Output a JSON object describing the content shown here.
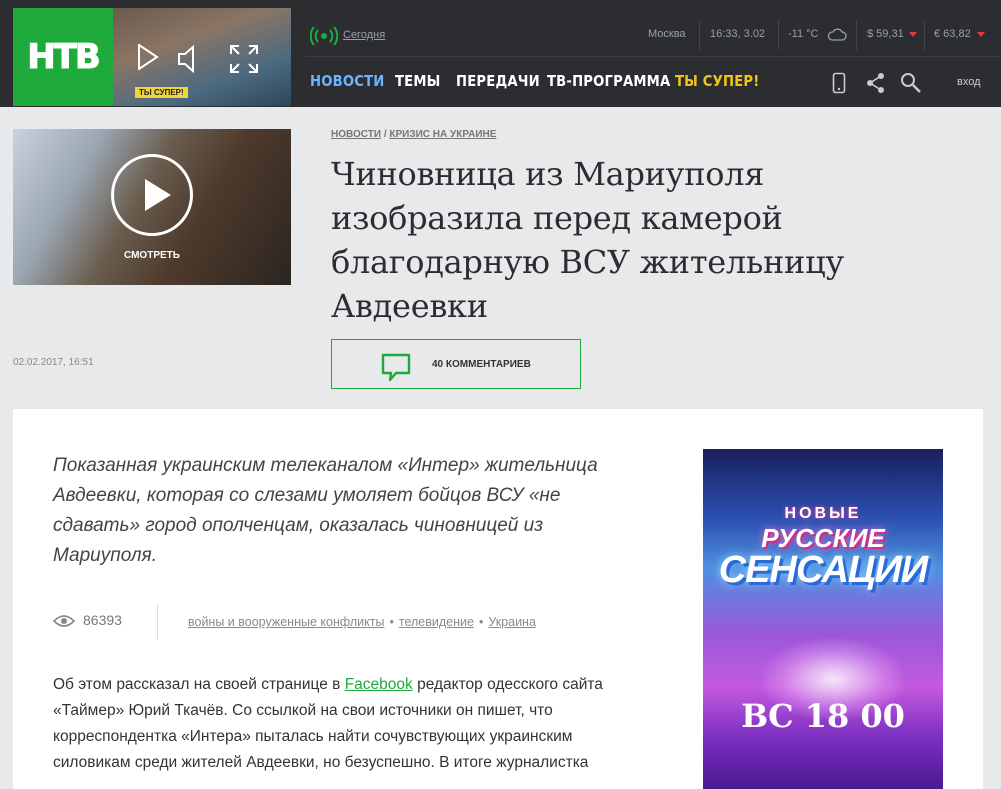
{
  "header": {
    "logo_text": "НТВ",
    "player_badge": "ТЫ СУПЕР!",
    "today_link": "Сегодня",
    "city": "Москва",
    "time": "16:33, 3.02",
    "temperature": "-11 °C",
    "usd": "$ 59,31",
    "eur": "€ 63,82",
    "nav": [
      {
        "label": "НОВОСТИ"
      },
      {
        "label": "ТЕМЫ"
      },
      {
        "label": "ПЕРЕДАЧИ"
      },
      {
        "label": "ТВ-ПРОГРАММА"
      },
      {
        "label": "ТЫ СУПЕР!"
      }
    ],
    "login": "вход"
  },
  "hero": {
    "watch_label": "СМОТРЕТЬ",
    "breadcrumbs": [
      "НОВОСТИ",
      "КРИЗИС НА УКРАИНЕ"
    ],
    "breadcrumb_sep": "/",
    "title": "Чиновница из Мариуполя изобразила перед камерой благодарную ВСУ жительницу Авдеевки",
    "date": "02.02.2017, 16:51",
    "comments_label": "40 КОММЕНТАРИЕВ"
  },
  "article": {
    "lead": "Показанная украинским телеканалом «Интер» жительница Авдеевки, которая со слезами умоляет бойцов ВСУ «не сдавать» город ополченцам, оказалась чиновницей из Мариуполя.",
    "views": "86393",
    "tags": [
      "войны и вооруженные конфликты",
      "телевидение",
      "Украина"
    ],
    "tag_sep": "•",
    "body_before_link": "Об этом рассказал на своей странице в ",
    "body_link": "Facebook",
    "body_after_link": " редактор одесского сайта «Таймер» Юрий Ткачёв. Со ссылкой на свои источники он пишет, что корреспондентка «Интера» пыталась найти сочувствующих украинским силовикам среди жителей Авдеевки, но безуспешно. В итоге журналистка"
  },
  "ad": {
    "line1": "НОВЫЕ",
    "line2": "РУССКИЕ",
    "line3": "СЕНСАЦИИ",
    "time": "ВС 18 00"
  },
  "colors": {
    "brand_green": "#1faa3c",
    "header_bg": "#2b2d31",
    "nav_active": "#6bb3ff",
    "nav_highlight": "#f0c419"
  }
}
